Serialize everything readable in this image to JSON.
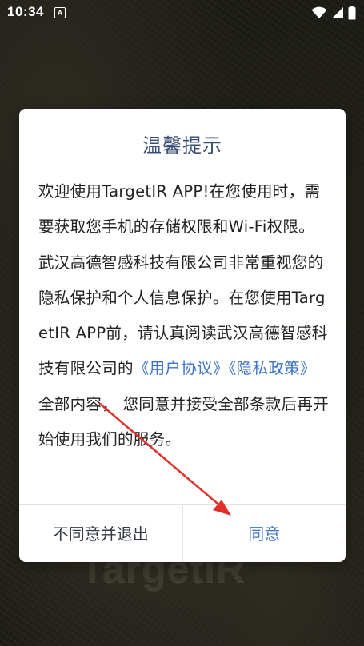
{
  "status_bar": {
    "time": "10:34",
    "notification_icon": "A"
  },
  "background": {
    "logo_text": "TargetIR"
  },
  "dialog": {
    "title": "温馨提示",
    "body": {
      "text_1": "欢迎使用TargetIR APP!在您使用时，需要获取您手机的存储权限和Wi-Fi权限。武汉高德智感科技有限公司非常重视您的隐私保护和个人信息保护。在您使用TargetIR APP前，请认真阅读武汉高德智感科技有限公司的",
      "link_1": "《用户协议》",
      "separator": "",
      "link_2": "《隐私政策》",
      "text_2": "全部内容， 您同意并接受全部条款后再开始使用我们的服务。"
    },
    "buttons": {
      "decline_label": "不同意并退出",
      "agree_label": "同意"
    }
  },
  "colors": {
    "title": "#3a4f75",
    "link": "#3a73c8",
    "annotation_arrow": "#e0302a"
  }
}
